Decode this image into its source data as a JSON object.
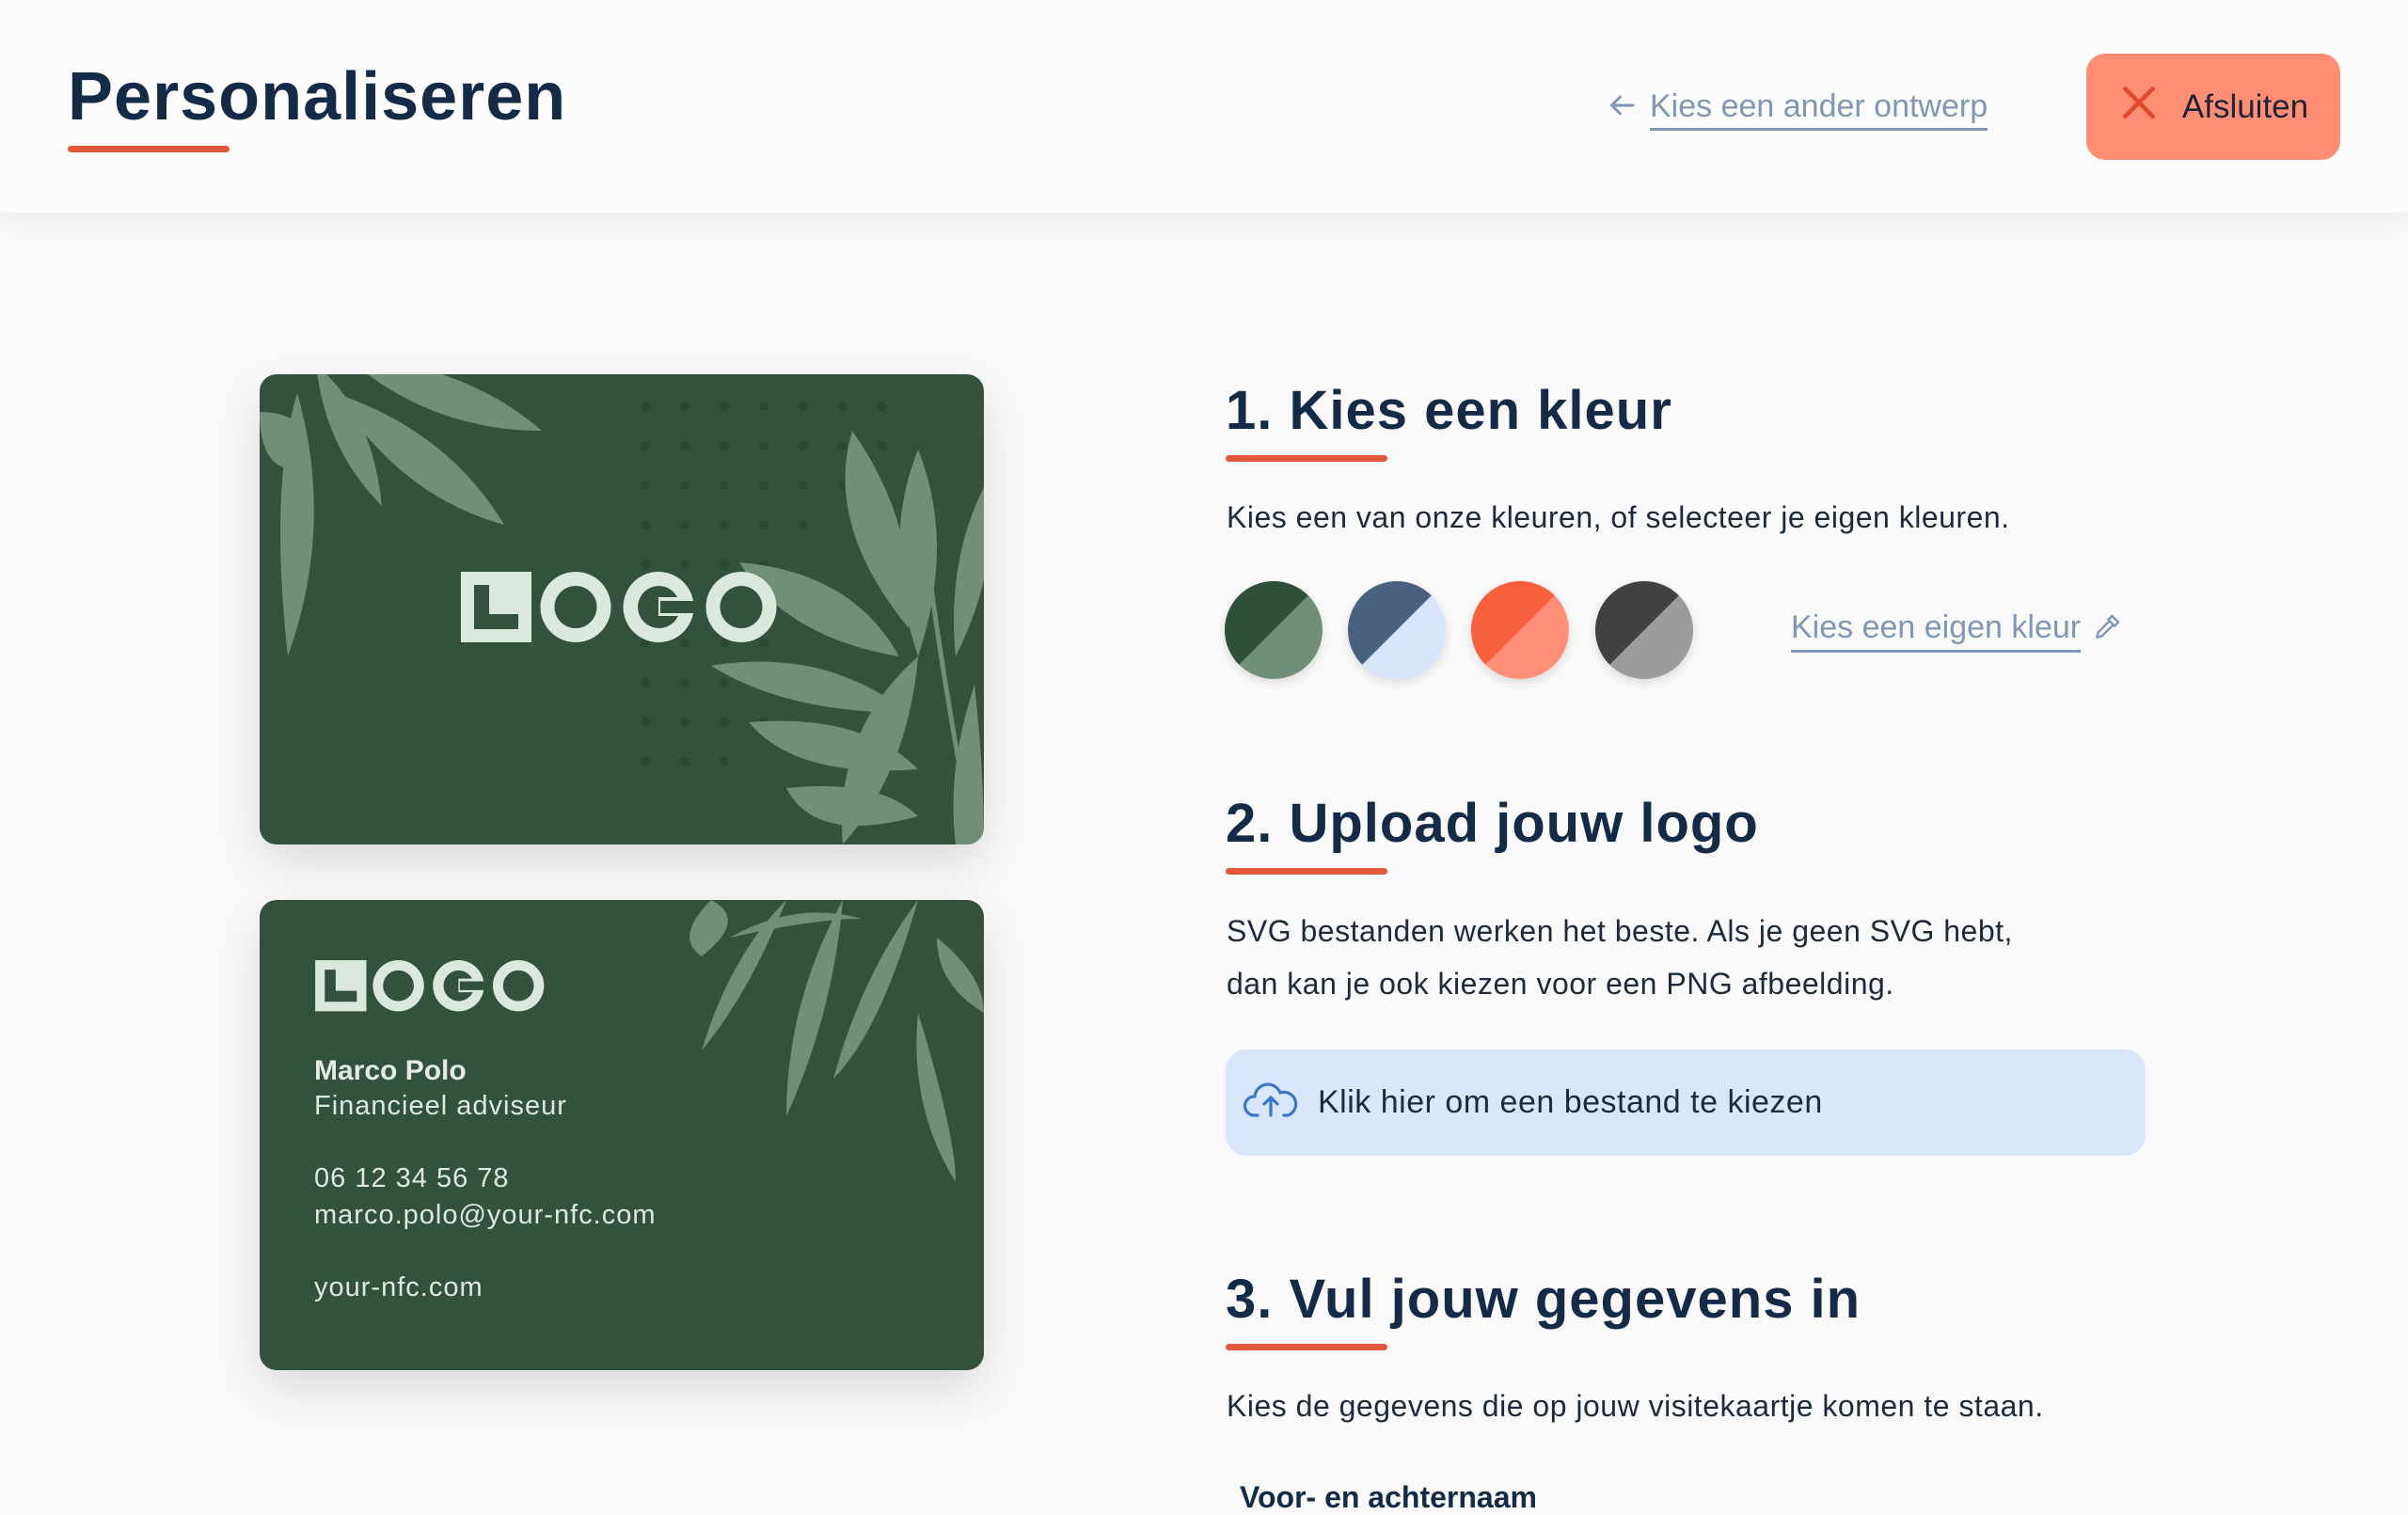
{
  "header": {
    "title": "Personaliseren",
    "back_link": "Kies een ander ontwerp",
    "close_label": "Afsluiten"
  },
  "card_front": {
    "logo_text": "LOGO"
  },
  "card_back": {
    "logo_text": "LOGO",
    "name": "Marco Polo",
    "role": "Financieel adviseur",
    "phone": "06 12 34 56 78",
    "email": "marco.polo@your-nfc.com",
    "website": "your-nfc.com"
  },
  "step1": {
    "title": "1. Kies een kleur",
    "description": "Kies een van onze kleuren, of selecteer je eigen kleuren.",
    "custom_color_link": "Kies een eigen kleur",
    "swatches": [
      {
        "name": "green",
        "primary": "#2f5139",
        "secondary": "#6f8f78"
      },
      {
        "name": "blue",
        "primary": "#4a6080",
        "secondary": "#d7e5fb"
      },
      {
        "name": "orange",
        "primary": "#f8603d",
        "secondary": "#ff8f78"
      },
      {
        "name": "grey",
        "primary": "#414141",
        "secondary": "#9b9b9b"
      }
    ]
  },
  "step2": {
    "title": "2. Upload jouw logo",
    "description_line1": "SVG bestanden werken het beste. Als je geen SVG hebt,",
    "description_line2": "dan kan je ook kiezen voor een PNG afbeelding.",
    "upload_label": "Klik hier om een bestand te kiezen"
  },
  "step3": {
    "title": "3. Vul jouw gegevens in",
    "description": "Kies de gegevens die op jouw visitekaartje komen te staan.",
    "field_label": "Voor- en achternaam"
  },
  "colors": {
    "accent": "#e2583a",
    "navy": "#142b47",
    "card_green": "#32513e",
    "close_button": "#ff8e75",
    "upload_bg": "#d8e7fc",
    "link": "#7f96b6"
  },
  "icons": {
    "back": "arrow-left-icon",
    "close": "close-icon",
    "custom_color": "pipette-icon",
    "upload": "cloud-upload-icon"
  }
}
